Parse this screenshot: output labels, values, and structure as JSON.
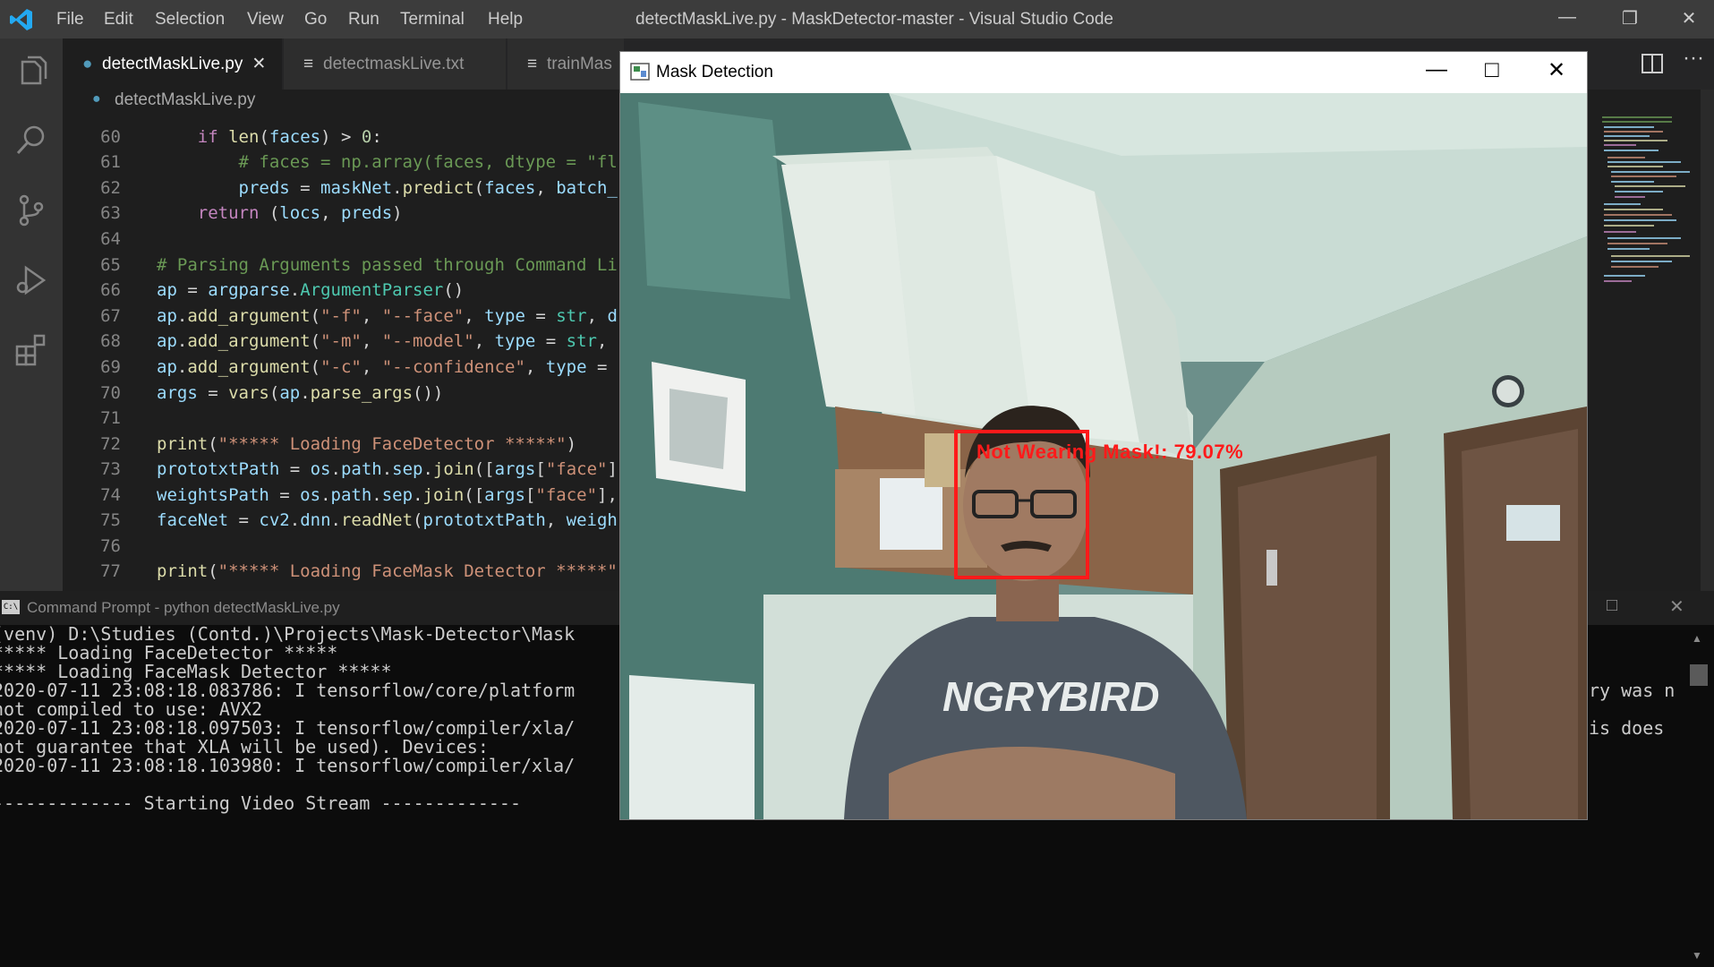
{
  "vscode": {
    "window_title": "detectMaskLive.py - MaskDetector-master - Visual Studio Code",
    "menu": [
      "File",
      "Edit",
      "Selection",
      "View",
      "Go",
      "Run",
      "Terminal",
      "Help"
    ],
    "tabs": [
      {
        "label": "detectMaskLive.py",
        "active": true
      },
      {
        "label": "detectmaskLive.txt",
        "active": false
      },
      {
        "label": "trainMas",
        "active": false
      }
    ],
    "breadcrumb": "detectMaskLive.py",
    "code_lines": [
      {
        "n": "60",
        "text": "    if len(faces) > 0:"
      },
      {
        "n": "61",
        "text": "        # faces = np.array(faces, dtype = \"fl"
      },
      {
        "n": "62",
        "text": "        preds = maskNet.predict(faces, batch_"
      },
      {
        "n": "63",
        "text": "    return (locs, preds)"
      },
      {
        "n": "64",
        "text": ""
      },
      {
        "n": "65",
        "text": "# Parsing Arguments passed through Command Li"
      },
      {
        "n": "66",
        "text": "ap = argparse.ArgumentParser()"
      },
      {
        "n": "67",
        "text": "ap.add_argument(\"-f\", \"--face\", type = str, d"
      },
      {
        "n": "68",
        "text": "ap.add_argument(\"-m\", \"--model\", type = str, "
      },
      {
        "n": "69",
        "text": "ap.add_argument(\"-c\", \"--confidence\", type = "
      },
      {
        "n": "70",
        "text": "args = vars(ap.parse_args())"
      },
      {
        "n": "71",
        "text": ""
      },
      {
        "n": "72",
        "text": "print(\"***** Loading FaceDetector *****\")"
      },
      {
        "n": "73",
        "text": "prototxtPath = os.path.sep.join([args[\"face\"]"
      },
      {
        "n": "74",
        "text": "weightsPath = os.path.sep.join([args[\"face\"],"
      },
      {
        "n": "75",
        "text": "faceNet = cv2.dnn.readNet(prototxtPath, weigh"
      },
      {
        "n": "76",
        "text": ""
      },
      {
        "n": "77",
        "text": "print(\"***** Loading FaceMask Detector *****\""
      }
    ]
  },
  "cmd": {
    "title": "Command Prompt - python  detectMaskLive.py",
    "lines": [
      "(venv) D:\\Studies (Contd.)\\Projects\\Mask-Detector\\Mask",
      "***** Loading FaceDetector *****",
      "***** Loading FaceMask Detector *****",
      "2020-07-11 23:08:18.083786: I tensorflow/core/platform",
      "not compiled to use: AVX2",
      "2020-07-11 23:08:18.097503: I tensorflow/compiler/xla/",
      "not guarantee that XLA will be used). Devices:",
      "2020-07-11 23:08:18.103980: I tensorflow/compiler/xla/",
      "",
      "------------- Starting Video Stream -------------"
    ],
    "right_fragments": [
      "ry was n",
      "is does"
    ]
  },
  "mask_window": {
    "title": "Mask Detection",
    "detection_label": "Not Wearing Mask!: 79.07%",
    "detection_color": "#ff1a1a"
  },
  "icons": [
    "vscode-logo-icon",
    "explorer-icon",
    "search-icon",
    "source-control-icon",
    "run-debug-icon",
    "extensions-icon",
    "python-file-icon",
    "split-editor-icon",
    "more-actions-icon",
    "minimize-icon",
    "maximize-icon",
    "close-icon",
    "cmd-icon",
    "opencv-window-icon"
  ]
}
